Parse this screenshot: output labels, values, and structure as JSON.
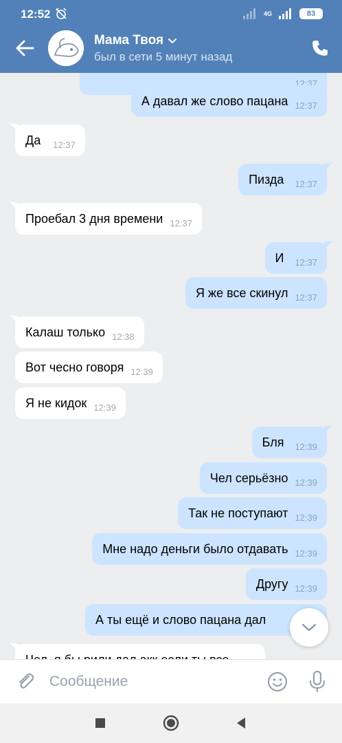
{
  "status_bar": {
    "time": "12:52",
    "network": "4G",
    "battery": "83"
  },
  "header": {
    "contact_name": "Мама Твоя",
    "contact_status": "был в сети 5 минут назад",
    "accent_color": "#5181b8"
  },
  "messages": [
    {
      "dir": "out",
      "text": "",
      "time": "12:37"
    },
    {
      "dir": "out",
      "text": "А давал же слово пацана",
      "time": "12:37"
    },
    {
      "dir": "in",
      "text": "Да",
      "time": "12:37"
    },
    {
      "dir": "out",
      "text": "Пизда",
      "time": "12:37"
    },
    {
      "dir": "in",
      "text": "Проебал 3 дня времени",
      "time": "12:37"
    },
    {
      "dir": "out",
      "text": "И",
      "time": "12:37"
    },
    {
      "dir": "out",
      "text": "Я же все скинул",
      "time": "12:37"
    },
    {
      "dir": "in",
      "text": "Калаш только",
      "time": "12:38"
    },
    {
      "dir": "in",
      "text": "Вот чесно говоря",
      "time": "12:39"
    },
    {
      "dir": "in",
      "text": "Я не кидок",
      "time": "12:39"
    },
    {
      "dir": "out",
      "text": "Бля",
      "time": "12:39"
    },
    {
      "dir": "out",
      "text": "Чел серьёзно",
      "time": "12:39"
    },
    {
      "dir": "out",
      "text": "Так не поступают",
      "time": "12:39"
    },
    {
      "dir": "out",
      "text": "Мне надо деньги было отдавать",
      "time": "12:39"
    },
    {
      "dir": "out",
      "text": "Другу",
      "time": "12:39"
    },
    {
      "dir": "out",
      "text": "А ты ещё и слово пацана дал",
      "time": ""
    },
    {
      "dir": "in",
      "text": "Чел, я бы рили дал акк если ты все",
      "time": ""
    }
  ],
  "composer": {
    "placeholder": "Сообщение"
  },
  "icons": {
    "back": "arrow-left-icon",
    "call": "phone-icon",
    "attach": "paperclip-icon",
    "emoji": "smiley-icon",
    "mic": "microphone-icon",
    "scroll": "chevron-down-icon"
  },
  "colors": {
    "incoming_bubble": "#ffffff",
    "outgoing_bubble": "#cce4ff",
    "background": "#edeef0"
  }
}
